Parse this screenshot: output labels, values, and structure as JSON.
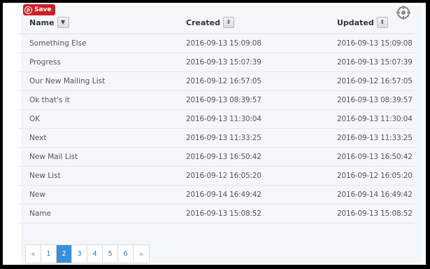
{
  "pin": {
    "label": "Save"
  },
  "columns": {
    "name": "Name",
    "created": "Created",
    "updated": "Updated"
  },
  "rows": [
    {
      "name": "Something Else",
      "created": "2016-09-13 15:09:08",
      "updated": "2016-09-13 15:09:08"
    },
    {
      "name": "Progress",
      "created": "2016-09-13 15:07:39",
      "updated": "2016-09-13 15:07:39"
    },
    {
      "name": "Our New Mailing List",
      "created": "2016-09-12 16:57:05",
      "updated": "2016-09-12 16:57:05"
    },
    {
      "name": "Ok that's it",
      "created": "2016-09-13 08:39:57",
      "updated": "2016-09-13 08:39:57"
    },
    {
      "name": "OK",
      "created": "2016-09-13 11:30:04",
      "updated": "2016-09-13 11:30:04"
    },
    {
      "name": "Next",
      "created": "2016-09-13 11:33:25",
      "updated": "2016-09-13 11:33:25"
    },
    {
      "name": "New Mail List",
      "created": "2016-09-13 16:50:42",
      "updated": "2016-09-13 16:50:42"
    },
    {
      "name": "New List",
      "created": "2016-09-12 16:05:20",
      "updated": "2016-09-12 16:05:20"
    },
    {
      "name": "New",
      "created": "2016-09-14 16:49:42",
      "updated": "2016-09-14 16:49:42"
    },
    {
      "name": "Name",
      "created": "2016-09-13 15:08:52",
      "updated": "2016-09-13 15:08:52"
    }
  ],
  "pagination": {
    "prev": "«",
    "pages": [
      "1",
      "2",
      "3",
      "4",
      "5",
      "6"
    ],
    "next": "»",
    "current": "2"
  },
  "icons": {
    "save": "pinterest-icon",
    "settings": "crosshair-gear-icon",
    "sort": "sort-arrows-icon",
    "dropdown": "caret-down-icon"
  },
  "colors": {
    "pin_red": "#cb2027",
    "active_page": "#3a8fd9",
    "link": "#337ab7",
    "panel_bg": "#f4f7fa"
  }
}
